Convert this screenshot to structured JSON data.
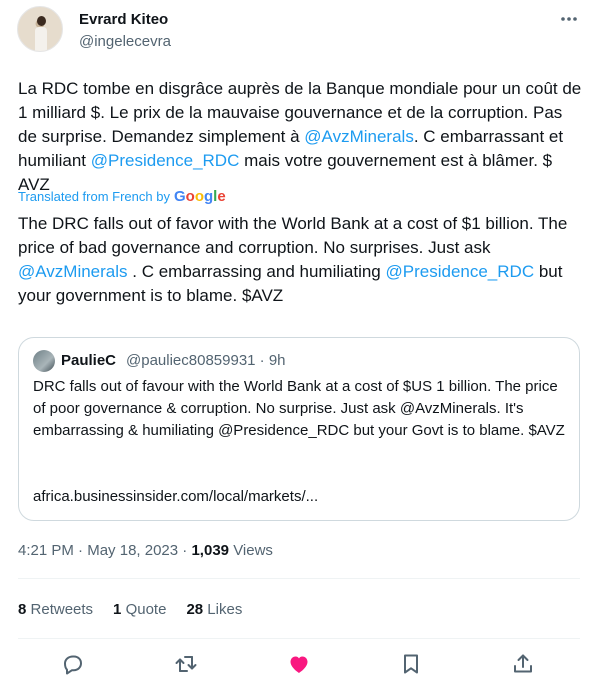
{
  "author": {
    "name": "Evrard Kiteo",
    "handle": "@ingelecevra",
    "avatar_icon": "profile-photo"
  },
  "more_icon": "more-options-icon",
  "tweet": {
    "original_text": {
      "part1": "La RDC tombe en disgrâce auprès de la Banque mondiale pour un coût de 1 milliard $. Le prix de la mauvaise gouvernance et de la corruption. Pas de surprise. Demandez simplement à ",
      "mention1": "@AvzMinerals",
      "part2": ". C embarrassant et humiliant ",
      "mention2": "@Presidence_RDC",
      "part3": " mais votre gouvernement est à blâmer. $ AVZ"
    },
    "translation_label": "Translated from French by",
    "translation_provider": "Google",
    "translated_text": {
      "part1": "The DRC falls out of favor with the World Bank at a cost of $1 billion. The price of bad governance and corruption. No surprises. Just ask ",
      "mention1": "@AvzMinerals",
      "part2": " . C embarrassing and humiliating ",
      "mention2": "@Presidence_RDC",
      "part3": " but your government is to blame. $AVZ"
    }
  },
  "quoted_tweet": {
    "name": "PaulieC",
    "handle": "@pauliec80859931",
    "separator": "·",
    "time": "9h",
    "text": "DRC falls out of favour with the World Bank at a cost of $US 1 billion.  The price of poor governance & corruption.  No surprise.  Just ask @AvzMinerals.  It's embarrassing & humiliating @Presidence_RDC but your Govt is to blame.  $AVZ",
    "link": "africa.businessinsider.com/local/markets/..."
  },
  "meta": {
    "time": "4:21 PM",
    "sep1": "·",
    "date": "May 18, 2023",
    "sep2": "·",
    "views_count": "1,039",
    "views_label": "Views"
  },
  "stats": {
    "retweets_count": "8",
    "retweets_label": "Retweets",
    "quotes_count": "1",
    "quotes_label": "Quote",
    "likes_count": "28",
    "likes_label": "Likes"
  },
  "actions": {
    "reply_icon": "reply-icon",
    "retweet_icon": "retweet-icon",
    "like_icon": "like-icon-filled",
    "bookmark_icon": "bookmark-icon",
    "share_icon": "share-icon",
    "like_color": "#f91880",
    "icon_color": "#536471"
  },
  "colors": {
    "link": "#1d9bf0",
    "secondary_text": "#536471",
    "primary_text": "#0f1419",
    "border": "#cfd9de"
  }
}
